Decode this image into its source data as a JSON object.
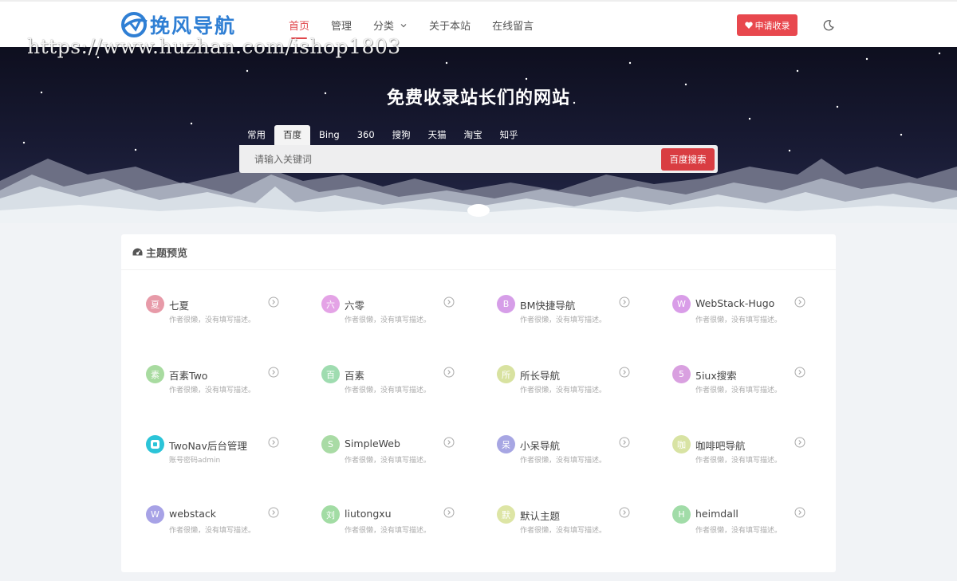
{
  "header": {
    "logo_text": "挽风导航",
    "nav": [
      {
        "label": "首页",
        "active": true
      },
      {
        "label": "管理"
      },
      {
        "label": "分类",
        "has_dropdown": true
      },
      {
        "label": "关于本站"
      },
      {
        "label": "在线留言"
      }
    ],
    "submit_label": "申请收录",
    "theme_icon": "moon-icon"
  },
  "watermark": "https://www.huzhan.com/ishop1803",
  "hero": {
    "title": "免费收录站长们的网站",
    "tabs": [
      "常用",
      "百度",
      "Bing",
      "360",
      "搜狗",
      "天猫",
      "淘宝",
      "知乎"
    ],
    "active_tab": "百度",
    "search_placeholder": "请输入关键词",
    "search_button": "百度搜索"
  },
  "section": {
    "title": "主题预览",
    "icon": "dashboard-icon",
    "sites": [
      {
        "avatar": "夏",
        "name": "七夏",
        "desc": "作者很懒，没有填写描述。",
        "color": "#e79aa8"
      },
      {
        "avatar": "六",
        "name": "六零",
        "desc": "作者很懒，没有填写描述。",
        "color": "#e4a3e6"
      },
      {
        "avatar": "B",
        "name": "BM快捷导航",
        "desc": "作者很懒，没有填写描述。",
        "color": "#d69ee8"
      },
      {
        "avatar": "W",
        "name": "WebStack-Hugo",
        "desc": "作者很懒，没有填写描述。",
        "color": "#d99de8"
      },
      {
        "avatar": "素",
        "name": "百素Two",
        "desc": "作者很懒，没有填写描述。",
        "color": "#a8dba0"
      },
      {
        "avatar": "百",
        "name": "百素",
        "desc": "作者很懒，没有填写描述。",
        "color": "#9fdcb0"
      },
      {
        "avatar": "所",
        "name": "所长导航",
        "desc": "作者很懒，没有填写描述。",
        "color": "#d8e2a0"
      },
      {
        "avatar": "5",
        "name": "5iux搜索",
        "desc": "作者很懒，没有填写描述。",
        "color": "#d9a0e0"
      },
      {
        "avatar": "",
        "name": "TwoNav后台管理",
        "desc": "账号密码admin",
        "color": "#2bc4d8",
        "logo": true
      },
      {
        "avatar": "S",
        "name": "SimpleWeb",
        "desc": "作者很懒，没有填写描述。",
        "color": "#a9dba5"
      },
      {
        "avatar": "呆",
        "name": "小呆导航",
        "desc": "作者很懒，没有填写描述。",
        "color": "#a7a6e3"
      },
      {
        "avatar": "咖",
        "name": "咖啡吧导航",
        "desc": "作者很懒，没有填写描述。",
        "color": "#d8e3a3"
      },
      {
        "avatar": "W",
        "name": "webstack",
        "desc": "作者很懒，没有填写描述。",
        "color": "#a7a2e6"
      },
      {
        "avatar": "刘",
        "name": "liutongxu",
        "desc": "作者很懒，没有填写描述。",
        "color": "#a2dca4"
      },
      {
        "avatar": "默",
        "name": "默认主题",
        "desc": "作者很懒，没有填写描述。",
        "color": "#dde5a5"
      },
      {
        "avatar": "H",
        "name": "heimdall",
        "desc": "作者很懒，没有填写描述。",
        "color": "#a1dca8"
      }
    ]
  }
}
